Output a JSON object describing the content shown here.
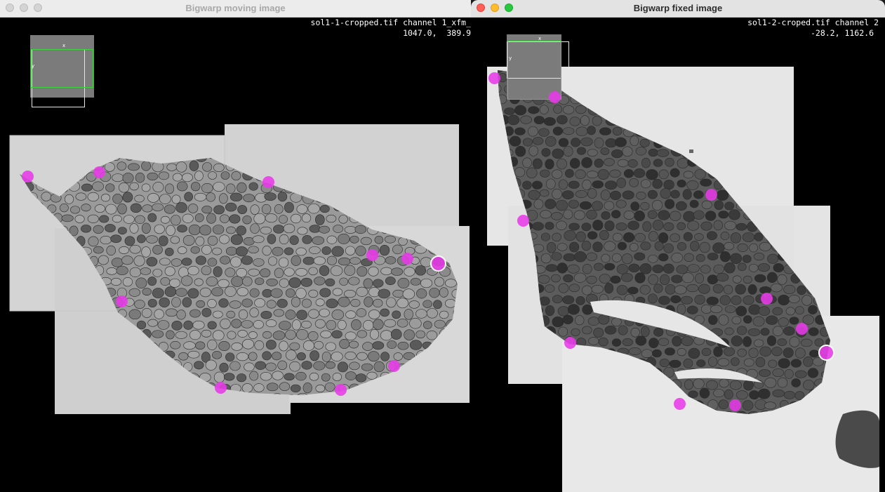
{
  "moving_window": {
    "title": "Bigwarp moving image",
    "source_label": "sol1-1-cropped.tif channel 1_xfm_",
    "coords": "1047.0,  389.9",
    "overview_x": "x",
    "overview_y": "y",
    "landmark_color": "#e83ae8",
    "landmarks": [
      {
        "id": "L1",
        "selected": false
      },
      {
        "id": "L2",
        "selected": false
      },
      {
        "id": "L3",
        "selected": false
      },
      {
        "id": "L4",
        "selected": false
      },
      {
        "id": "L5",
        "selected": false
      },
      {
        "id": "L6",
        "selected": false
      },
      {
        "id": "L7",
        "selected": true
      },
      {
        "id": "L8",
        "selected": false
      },
      {
        "id": "L9",
        "selected": false
      },
      {
        "id": "L10",
        "selected": false
      },
      {
        "id": "L11",
        "selected": false
      }
    ]
  },
  "fixed_window": {
    "title": "Bigwarp fixed image",
    "source_label": "sol1-2-croped.tif channel 2",
    "coords": "-28.2, 1162.6",
    "overview_x": "x",
    "overview_y": "y",
    "landmark_color": "#e83ae8",
    "landmarks": [
      {
        "id": "L1",
        "selected": false
      },
      {
        "id": "L2",
        "selected": false
      },
      {
        "id": "L3",
        "selected": false
      },
      {
        "id": "L4",
        "selected": false
      },
      {
        "id": "L5",
        "selected": false
      },
      {
        "id": "L6",
        "selected": false
      },
      {
        "id": "L7",
        "selected": false
      },
      {
        "id": "L8",
        "selected": true
      },
      {
        "id": "L9",
        "selected": false
      },
      {
        "id": "L10",
        "selected": false
      },
      {
        "id": "L11",
        "selected": false
      }
    ]
  },
  "colors": {
    "overview_view": "#3ed43e",
    "tissue_background": "#d6d6d6",
    "fiber_light": "#8c8c8c",
    "fiber_dark": "#3a3a3a"
  }
}
